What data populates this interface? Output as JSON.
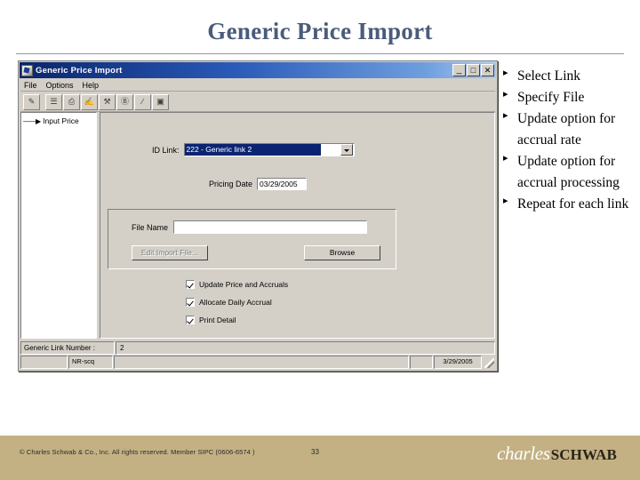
{
  "slide": {
    "title": "Generic Price Import",
    "background_color": "#ffffff",
    "title_color": "#4a5c7a"
  },
  "bullets": [
    {
      "marker": "▸",
      "text": "Select Link"
    },
    {
      "marker": "▸",
      "text": "Specify File"
    },
    {
      "marker": "▸",
      "text": "Update option for accrual rate"
    },
    {
      "marker": "▸",
      "text": "Update option for accrual processing"
    },
    {
      "marker": "▸",
      "text": "Repeat for each link"
    }
  ],
  "app_window": {
    "title": "Generic Price Import",
    "titlebar_icon": "app-icon",
    "window_buttons": [
      {
        "name": "minimize",
        "glyph": "_"
      },
      {
        "name": "maximize",
        "glyph": "□"
      },
      {
        "name": "close",
        "glyph": "✕"
      }
    ],
    "menus": [
      {
        "label": "File",
        "accel": "F"
      },
      {
        "label": "Options",
        "accel": "O"
      },
      {
        "label": "Help",
        "accel": "H"
      }
    ],
    "toolbar": [
      {
        "name": "new-record-icon",
        "glyph": "✎"
      },
      {
        "name": "list-view-icon",
        "glyph": "☰"
      },
      {
        "name": "print-icon",
        "glyph": "⎙"
      },
      {
        "name": "edit-document-icon",
        "glyph": "✍"
      },
      {
        "name": "properties-icon",
        "glyph": "⚒"
      },
      {
        "name": "find-replace-icon",
        "glyph": "Ⓑ"
      },
      {
        "name": "clear-icon",
        "glyph": "∕"
      },
      {
        "name": "preview-icon",
        "glyph": "▣"
      }
    ],
    "tree": {
      "arrow": "——▶",
      "node_label": "Input Price"
    },
    "form": {
      "id_link_label": "ID Link:",
      "id_link_value": "222 - Generic link 2",
      "pricing_date_label": "Pricing Date",
      "pricing_date_value": "03/29/2005",
      "file_name_label": "File Name",
      "file_name_value": "",
      "edit_import_file_label": "Edit Import File...",
      "edit_import_file_accel": "E",
      "browse_label": "Browse",
      "browse_accel": "B"
    },
    "checkboxes": [
      {
        "label": "Update Price and Accruals",
        "accel": "U",
        "checked": true
      },
      {
        "label": "Allocate Daily Accrual",
        "accel": "A",
        "checked": true
      },
      {
        "label": "Print Detail",
        "accel": "D",
        "checked": true
      }
    ],
    "link_number": {
      "label": "Generic Link Number :",
      "value": "2"
    },
    "status_bar": {
      "user": "NR-scq",
      "message": "",
      "date": "3/29/2005"
    }
  },
  "footer": {
    "copyright": "© Charles Schwab & Co., Inc.  All rights reserved.  Member SIPC  (0606-6574 )",
    "page_number": "33",
    "logo_primary": "charles",
    "logo_secondary": "SCHWAB",
    "band_color": "#c3b184"
  }
}
